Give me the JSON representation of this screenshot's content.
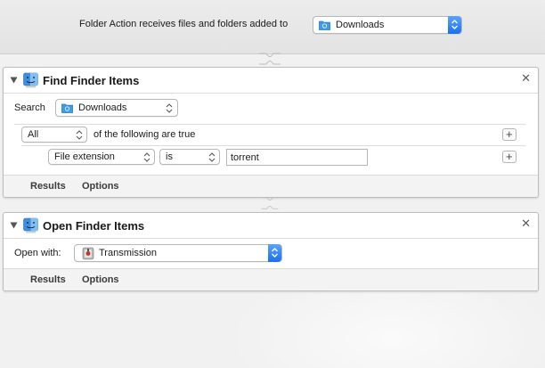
{
  "colors": {
    "accent": "#1b6ff0",
    "folder": "#3d9be9"
  },
  "trigger": {
    "label": "Folder Action receives files and folders added to",
    "folder": "Downloads",
    "folder_icon": "folder-icon",
    "stepper_icon": "popup-stepper-icon"
  },
  "actions": [
    {
      "title": "Find Finder Items",
      "icon": "finder-icon",
      "search_label": "Search",
      "search_location": "Downloads",
      "condition_quantifier": "All",
      "condition_suffix": "of the following are true",
      "criteria": [
        {
          "attribute": "File extension",
          "operator": "is",
          "value": "torrent"
        }
      ],
      "footer_tabs": [
        "Results",
        "Options"
      ]
    },
    {
      "title": "Open Finder Items",
      "icon": "finder-icon",
      "open_with_label": "Open with:",
      "open_with_app": "Transmission",
      "app_icon": "transmission-icon",
      "footer_tabs": [
        "Results",
        "Options"
      ]
    }
  ]
}
